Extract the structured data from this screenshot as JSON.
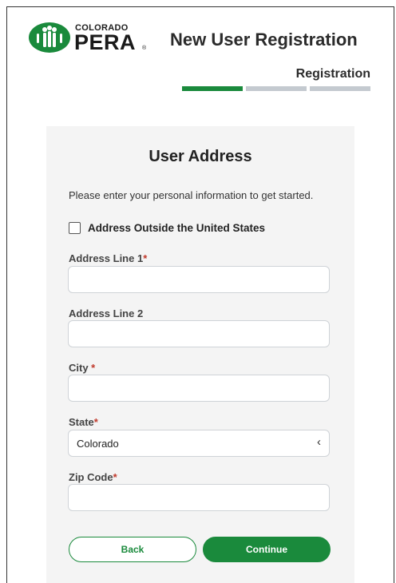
{
  "header": {
    "logo_small": "COLORADO",
    "logo_big": "PERA",
    "logo_reg": "®",
    "title": "New User Registration",
    "step_label": "Registration",
    "progress": {
      "total_steps": 3,
      "current_step": 1
    }
  },
  "form": {
    "title": "User Address",
    "intro": "Please enter your personal information to get started.",
    "outside_us_label": "Address Outside the United States",
    "outside_us_checked": false,
    "fields": {
      "address1": {
        "label": "Address Line 1",
        "required_mark": "*",
        "value": ""
      },
      "address2": {
        "label": "Address Line 2",
        "value": ""
      },
      "city": {
        "label": "City ",
        "required_mark": "*",
        "value": ""
      },
      "state": {
        "label": "State",
        "required_mark": "*",
        "value": "Colorado"
      },
      "zip": {
        "label": "Zip Code",
        "required_mark": "*",
        "value": ""
      }
    },
    "buttons": {
      "back": "Back",
      "continue": "Continue"
    }
  },
  "colors": {
    "brand_green": "#1a8a3c",
    "progress_inactive": "#c4cad0",
    "required_red": "#c0392b",
    "card_background": "#f4f4f4"
  },
  "icons": {
    "logo": "pera-people-logo-icon",
    "select_chevron": "chevron-left-icon"
  }
}
